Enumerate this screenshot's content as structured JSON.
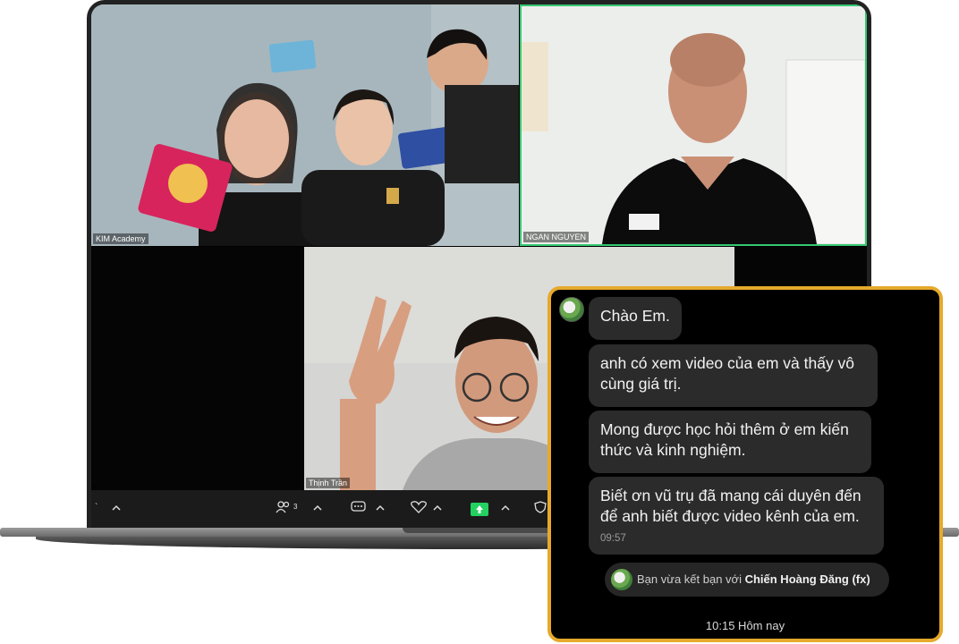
{
  "tiles": [
    {
      "label": "KIM Academy"
    },
    {
      "label": "NGAN NGUYEN"
    },
    {
      "label": ""
    },
    {
      "label": "Thịnh Trần"
    }
  ],
  "toolbar": {
    "participants_count": "3",
    "icons": [
      "chevron-up-icon",
      "participants-icon",
      "chat-icon",
      "reactions-icon",
      "share-screen-icon",
      "security-icon"
    ],
    "accent_color": "#23d160"
  },
  "chat": {
    "border_color": "#e6a92b",
    "messages": [
      {
        "text": "Chào Em."
      },
      {
        "text": "anh có xem video của em và thấy vô cùng giá trị."
      },
      {
        "text": "Mong được học hỏi thêm ở em kiến thức và kinh nghiệm."
      },
      {
        "text": "Biết ơn vũ trụ đã mang cái duyên đến để anh biết được video kênh của em.",
        "time": "09:57"
      }
    ],
    "friend_notice_prefix": "Bạn vừa kết bạn với",
    "friend_name": "Chiến Hoàng Đăng (fx)",
    "footer_time": "10:15 Hôm nay"
  }
}
